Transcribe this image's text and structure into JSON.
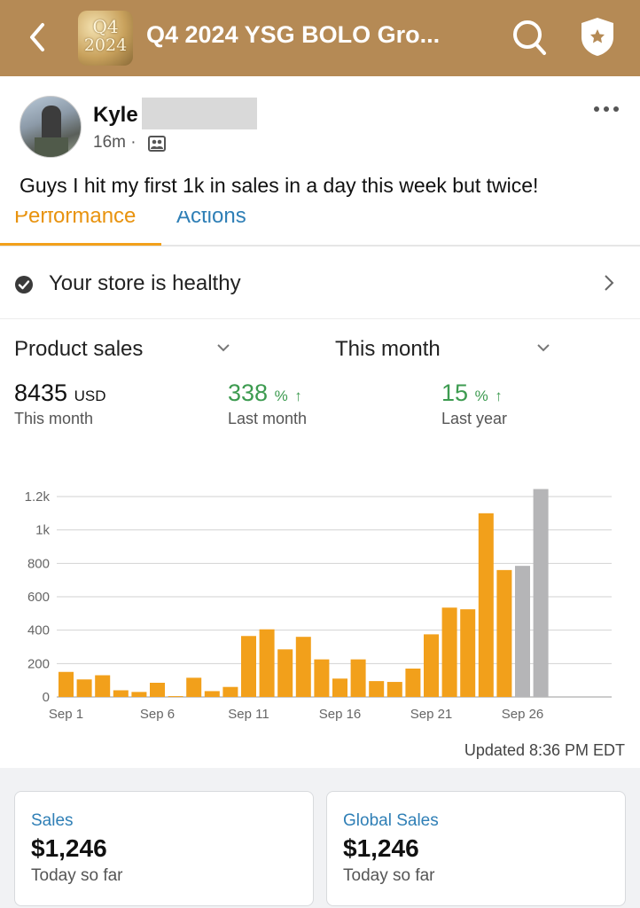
{
  "topbar": {
    "group_thumb_line1": "Q4",
    "group_thumb_line2": "2024",
    "title": "Q4 2024 YSG BOLO Gro...",
    "bg_color": "#b58a55"
  },
  "post": {
    "author": "Kyle",
    "time": "16m ·",
    "text": "Guys I hit my first 1k in sales in a day this week but twice!",
    "icons": [
      "back-arrow-icon",
      "search-icon",
      "shield-star-icon",
      "audience-icon",
      "more-options-icon"
    ]
  },
  "store": {
    "tabs": [
      {
        "label": "Performance",
        "active": true
      },
      {
        "label": "Actions",
        "active": false
      }
    ],
    "health_text": "Your store is healthy",
    "selector_metric": "Product sales",
    "selector_period": "This month",
    "metrics": [
      {
        "value": "8435",
        "unit": "USD",
        "label": "This month"
      },
      {
        "value": "338",
        "unit": "%",
        "label": "Last month"
      },
      {
        "value": "15",
        "unit": "%",
        "label": "Last year"
      }
    ],
    "updated": "Updated 8:36 PM EDT",
    "cards": [
      {
        "title": "Sales",
        "value": "$1,246",
        "sub": "Today so far"
      },
      {
        "title": "Global Sales",
        "value": "$1,246",
        "sub": "Today so far"
      }
    ],
    "colors": {
      "accent": "#f2a01b",
      "projected": "#b5b5b7",
      "positive": "#3d9b50",
      "link": "#2f7fb6"
    }
  },
  "chart_data": {
    "type": "bar",
    "x_tick_labels": [
      "Sep 1",
      "Sep 6",
      "Sep 11",
      "Sep 16",
      "Sep 21",
      "Sep 26"
    ],
    "y_tick_labels": [
      "0",
      "200",
      "400",
      "600",
      "800",
      "1k",
      "1.2k"
    ],
    "ylim": [
      0,
      1200
    ],
    "categories": [
      "Sep 1",
      "Sep 2",
      "Sep 3",
      "Sep 4",
      "Sep 5",
      "Sep 6",
      "Sep 7",
      "Sep 8",
      "Sep 9",
      "Sep 10",
      "Sep 11",
      "Sep 12",
      "Sep 13",
      "Sep 14",
      "Sep 15",
      "Sep 16",
      "Sep 17",
      "Sep 18",
      "Sep 19",
      "Sep 20",
      "Sep 21",
      "Sep 22",
      "Sep 23",
      "Sep 24",
      "Sep 25",
      "Sep 26",
      "Sep 27"
    ],
    "values": [
      150,
      105,
      130,
      40,
      30,
      85,
      5,
      115,
      35,
      60,
      365,
      405,
      285,
      360,
      225,
      110,
      225,
      95,
      90,
      170,
      375,
      535,
      525,
      1100,
      760,
      785,
      1245
    ],
    "projected": [
      false,
      false,
      false,
      false,
      false,
      false,
      false,
      false,
      false,
      false,
      false,
      false,
      false,
      false,
      false,
      false,
      false,
      false,
      false,
      false,
      false,
      false,
      false,
      false,
      false,
      true,
      true
    ],
    "grid": true
  }
}
